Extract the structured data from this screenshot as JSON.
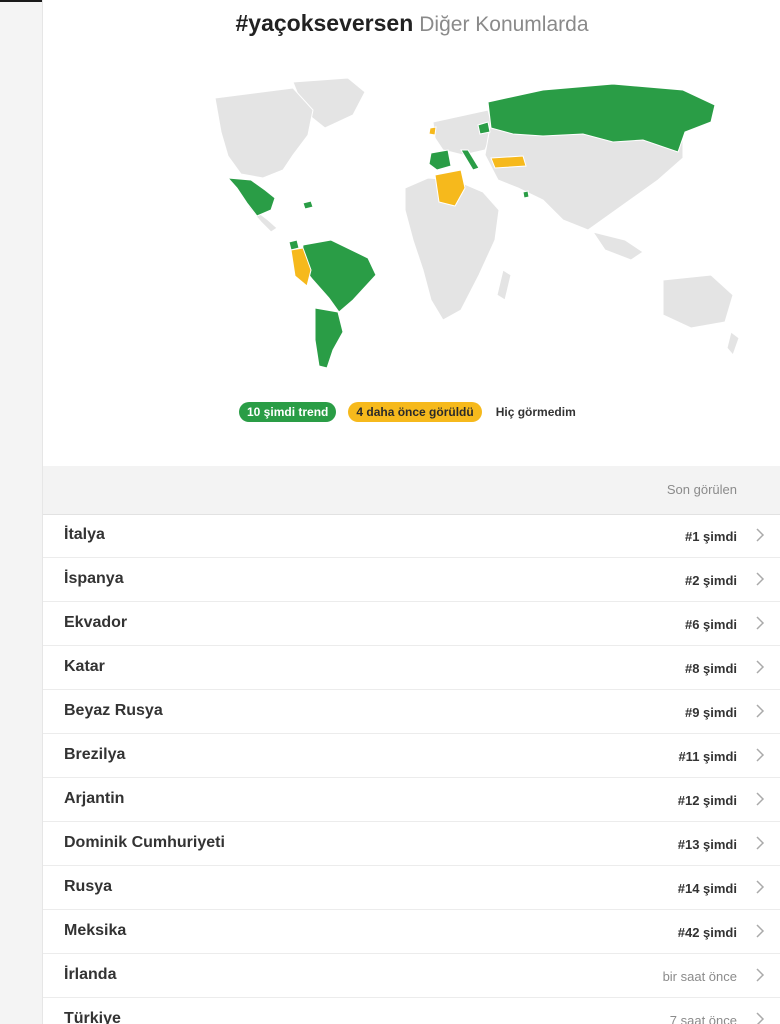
{
  "header": {
    "hashtag": "#yaçokseversen",
    "subtitle": "Diğer Konumlarda"
  },
  "legend": {
    "trending_now": "10 şimdi trend",
    "seen_before": "4 daha önce görüldü",
    "never_seen": "Hiç görmedim"
  },
  "colors": {
    "trending": "#2a9d46",
    "seen_before": "#f6b91c",
    "land": "#e4e4e4"
  },
  "list": {
    "column_header": "Son görülen",
    "rows": [
      {
        "name": "İtalya",
        "status": "#1 şimdi",
        "current": true
      },
      {
        "name": "İspanya",
        "status": "#2 şimdi",
        "current": true
      },
      {
        "name": "Ekvador",
        "status": "#6 şimdi",
        "current": true
      },
      {
        "name": "Katar",
        "status": "#8 şimdi",
        "current": true
      },
      {
        "name": "Beyaz Rusya",
        "status": "#9 şimdi",
        "current": true
      },
      {
        "name": "Brezilya",
        "status": "#11 şimdi",
        "current": true
      },
      {
        "name": "Arjantin",
        "status": "#12 şimdi",
        "current": true
      },
      {
        "name": "Dominik Cumhuriyeti",
        "status": "#13 şimdi",
        "current": true
      },
      {
        "name": "Rusya",
        "status": "#14 şimdi",
        "current": true
      },
      {
        "name": "Meksika",
        "status": "#42 şimdi",
        "current": true
      },
      {
        "name": "İrlanda",
        "status": "bir saat önce",
        "current": false
      },
      {
        "name": "Türkiye",
        "status": "7 saat önce",
        "current": false
      }
    ]
  }
}
